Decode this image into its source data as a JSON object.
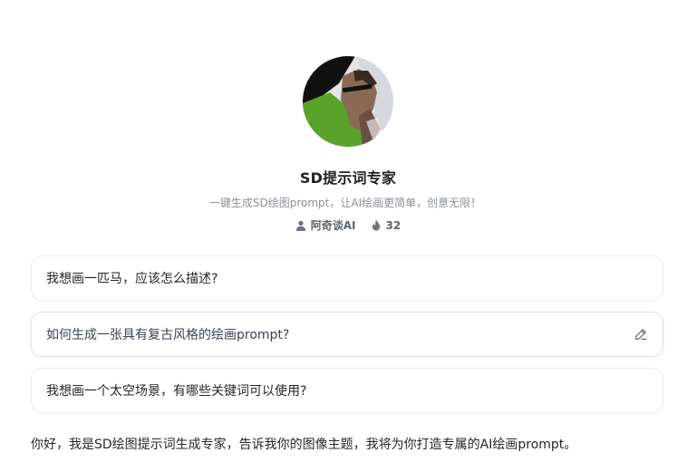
{
  "bot": {
    "name": "SD提示词专家",
    "description": "一键生成SD绘图prompt，让AI绘画更简单，创意无限！",
    "author": "阿奇谈AI",
    "usage_count": "32",
    "author_icon": "user-icon",
    "usage_icon": "flame-icon"
  },
  "suggestions": [
    {
      "label": "我想画一匹马，应该怎么描述?"
    },
    {
      "label": "如何生成一张具有复古风格的绘画prompt?",
      "icon": "edit-icon"
    },
    {
      "label": "我想画一个太空场景，有哪些关键词可以使用?"
    }
  ],
  "welcome_message": "你好，我是SD绘图提示词生成专家，告诉我你的图像主题，我将为你打造专属的AI绘画prompt。",
  "colors": {
    "avatar_green": "#5aa32a",
    "avatar_black": "#111111",
    "avatar_gray": "#d9dcdf",
    "muted_text": "#8a8f98",
    "border": "#e8eaee"
  }
}
